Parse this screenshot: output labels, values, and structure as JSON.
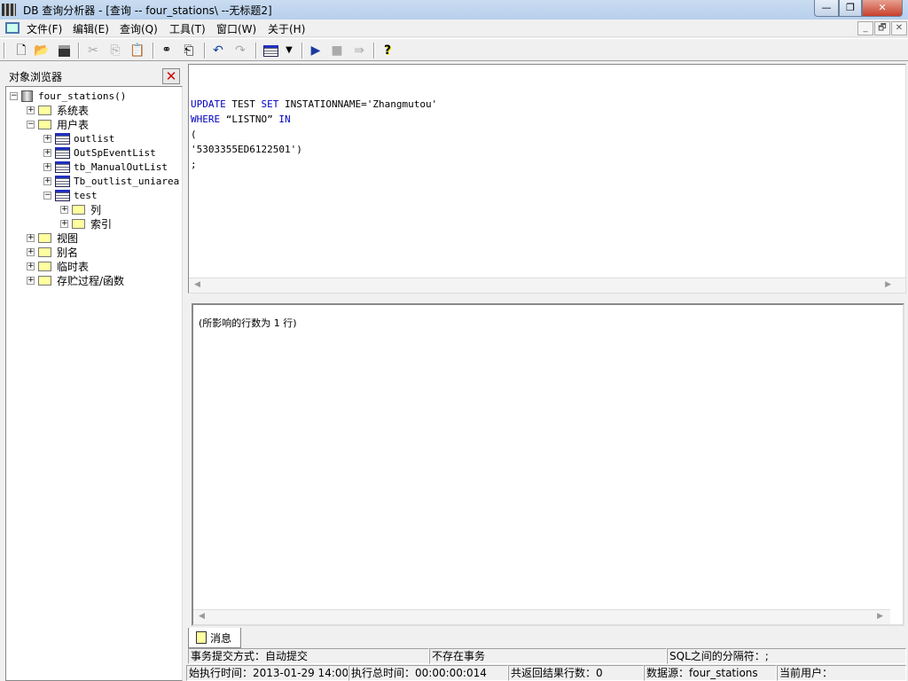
{
  "window": {
    "title": "DB 查询分析器 - [查询 -- four_stations\\  --无标题2]",
    "minimize": "—",
    "restore": "❐",
    "close": "✕"
  },
  "menu": {
    "items": [
      "文件(F)",
      "编辑(E)",
      "查询(Q)",
      "工具(T)",
      "窗口(W)",
      "关于(H)"
    ],
    "mdi_min": "_",
    "mdi_restore": "🗗",
    "mdi_close": "✕"
  },
  "toolbar": {
    "icons": [
      "new-icon",
      "open-icon",
      "save-icon",
      "cut-icon",
      "copy-icon",
      "paste-icon",
      "find-icon",
      "replace-icon",
      "undo-icon",
      "redo-icon",
      "grid-icon",
      "dropdown-icon",
      "execute-icon",
      "stop-icon",
      "export-icon",
      "help-icon"
    ]
  },
  "object_browser": {
    "title": "对象浏览器",
    "close": "✕",
    "tree": {
      "root": "four_stations()",
      "system_tables": "系统表",
      "user_tables": "用户表",
      "tables": [
        "outlist",
        "OutSpEventList",
        "tb_ManualOutList",
        "Tb_outlist_uniarea",
        "test"
      ],
      "test_children": [
        "列",
        "索引"
      ],
      "others": [
        "视图",
        "别名",
        "临时表",
        "存贮过程/函数"
      ]
    }
  },
  "editor": {
    "lines": [
      [
        {
          "t": "UPDATE",
          "k": true
        },
        {
          "t": " TEST ",
          "k": false
        },
        {
          "t": "SET",
          "k": true
        },
        {
          "t": " INSTATIONNAME='Zhangmutou'",
          "k": false
        }
      ],
      [
        {
          "t": "WHERE",
          "k": true
        },
        {
          "t": " “LISTNO” ",
          "k": false
        },
        {
          "t": "IN",
          "k": true
        }
      ],
      [
        {
          "t": "(",
          "k": false
        }
      ],
      [
        {
          "t": "'5303355ED6122501')",
          "k": false
        }
      ],
      [
        {
          "t": ";",
          "k": false
        }
      ]
    ],
    "colors": {
      "keyword": "#0000c0"
    }
  },
  "results": {
    "message": "(所影响的行数为 1 行)",
    "tab_label": "消息"
  },
  "status": {
    "row1": [
      "事务提交方式：自动提交",
      "不存在事务",
      "SQL之间的分隔符：;"
    ],
    "row2": [
      "始执行时间：2013-01-29 14:00:",
      "执行总时间：00:00:00:014",
      "共返回结果行数：0",
      "数据源：four_stations",
      "当前用户："
    ]
  }
}
